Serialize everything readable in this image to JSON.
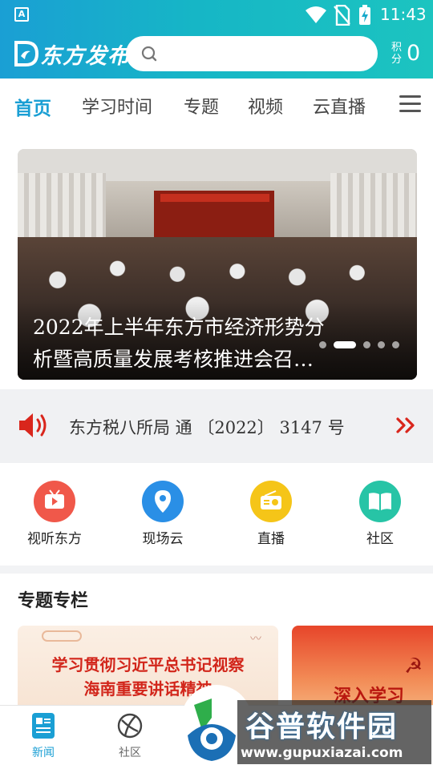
{
  "status_bar": {
    "time": "11:43",
    "notification_icon": "A"
  },
  "header": {
    "logo_text": "东方发布",
    "points_label": "积分",
    "points_value": "0"
  },
  "search": {
    "placeholder": ""
  },
  "tabs": [
    {
      "label": "首页",
      "active": true
    },
    {
      "label": "学习时间"
    },
    {
      "label": "专题"
    },
    {
      "label": "视频"
    },
    {
      "label": "云直播"
    }
  ],
  "banner": {
    "caption_line1": "2022年上半年东方市经济形势分",
    "caption_line2": "析暨高质量发展考核推进会召…",
    "slide_count": 5,
    "active_slide": 2
  },
  "notice": {
    "text": "东方税八所局 通 〔2022〕 3147 号"
  },
  "quick_menu": [
    {
      "label": "视听东方",
      "icon": "tv-icon",
      "color": "#f0584a"
    },
    {
      "label": "现场云",
      "icon": "location-pin-icon",
      "color": "#2a8fe6"
    },
    {
      "label": "直播",
      "icon": "radio-icon",
      "color": "#f5c518"
    },
    {
      "label": "社区",
      "icon": "book-icon",
      "color": "#27c4a6"
    }
  ],
  "special": {
    "title": "专题专栏",
    "card1_line1": "学习贯彻习近平总书记视察",
    "card1_line2": "海南重要讲话精神",
    "card2_text": "深入学习"
  },
  "bottom_nav": [
    {
      "label": "新闻",
      "icon": "news-icon",
      "active": true
    },
    {
      "label": "社区",
      "icon": "community-icon"
    }
  ],
  "watermark": {
    "title": "谷普软件园",
    "url": "www.gupuxiazai.com"
  },
  "colors": {
    "brand": "#1a9fd4",
    "header_end": "#1cc4c0",
    "notice_red": "#d9261c"
  }
}
